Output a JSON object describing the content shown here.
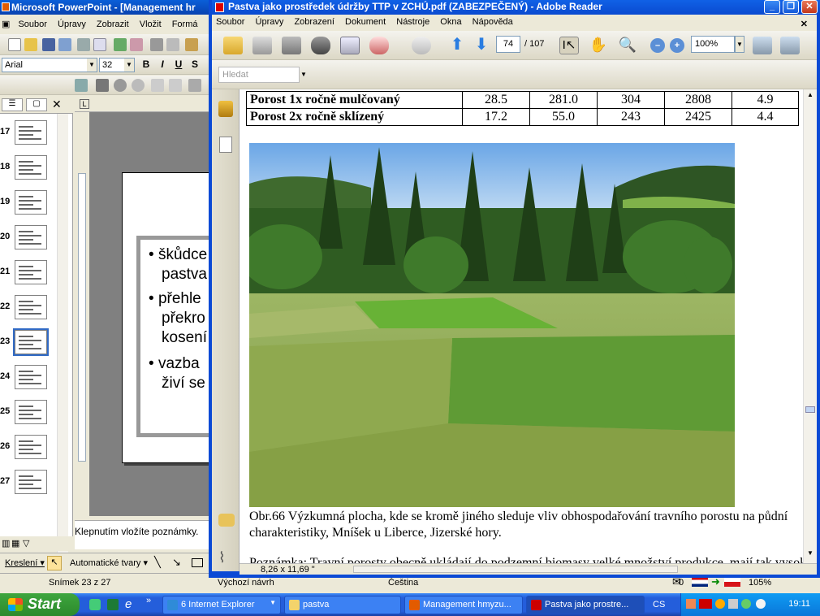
{
  "powerpoint": {
    "title": "Microsoft PowerPoint - [Management hr",
    "menu": [
      "Soubor",
      "Úpravy",
      "Zobrazit",
      "Vložit",
      "Formá"
    ],
    "font_name": "Arial",
    "font_size": "32",
    "format_buttons": [
      "B",
      "I",
      "U",
      "S"
    ],
    "thumbnails": [
      "17",
      "18",
      "19",
      "20",
      "21",
      "22",
      "23",
      "24",
      "25",
      "26",
      "27"
    ],
    "selected_thumbnail": "23",
    "slide_bullets": [
      "škůdce",
      "pastva",
      "přehle",
      "překro",
      "kosení",
      "vazba",
      "živí se"
    ],
    "notes_placeholder": "Klepnutím vložíte poznámky.",
    "draw_label": "Kreslení ▾",
    "autoshapes_label": "Automatické tvary ▾",
    "status": {
      "slide": "Snímek 23 z 27",
      "design": "Výchozí návrh",
      "language": "Čeština",
      "zoom": "105%"
    }
  },
  "reader": {
    "title": "Pastva jako prostředek údržby TTP v ZCHÚ.pdf (ZABEZPEČENÝ) - Adobe Reader",
    "menu": [
      "Soubor",
      "Úpravy",
      "Zobrazení",
      "Dokument",
      "Nástroje",
      "Okna",
      "Nápověda"
    ],
    "page_current": "74",
    "page_total": "/ 107",
    "zoom": "100%",
    "search_placeholder": "Hledat",
    "page_size": "8,26 x 11,69 \"",
    "table_rows": [
      {
        "label": "Porost 1x ročně mulčovaný",
        "v1": "28.5",
        "v2": "281.0",
        "v3": "304",
        "v4": "2808",
        "v5": "4.9"
      },
      {
        "label": "Porost 2x ročně sklízený",
        "v1": "17.2",
        "v2": "55.0",
        "v3": "243",
        "v4": "2425",
        "v5": "4.4"
      }
    ],
    "caption": "Obr.66  Výzkumná plocha, kde se kromě jiného sleduje vliv obhospodařování travního porostu na půdní charakteristiky, Mníšek u Liberce, Jizerské hory.",
    "note_partial": "Poznámka: Travní porosty obecně ukládají do podzemní biomasy velké množství produkce, mají tak vysokou"
  },
  "taskbar": {
    "start": "Start",
    "tasks": [
      "6 Internet Explorer",
      "pastva",
      "Management hmyzu...",
      "Pastva jako prostre..."
    ],
    "tray_lang": "CS",
    "tray_counter": "0",
    "clock": "19:11"
  },
  "colors": {
    "xp_blue": "#0a4ad0",
    "xp_green": "#2c8a2c",
    "pdf_red": "#cc0000"
  }
}
